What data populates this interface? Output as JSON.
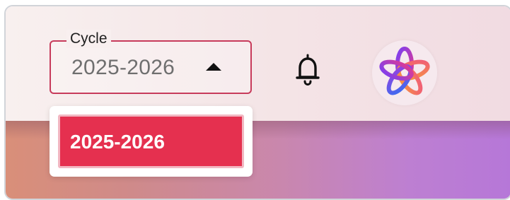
{
  "cycle_select": {
    "label": "Cycle",
    "selected_value": "2025-2026",
    "caret_icon": "caret-up-icon"
  },
  "dropdown": {
    "options": [
      {
        "label": "2025-2026",
        "selected": true
      }
    ]
  },
  "header": {
    "notification_icon": "bell-icon",
    "avatar_icon": "flower-logo-icon"
  },
  "colors": {
    "accent": "#e5304f",
    "select_border": "#c73b5b"
  }
}
